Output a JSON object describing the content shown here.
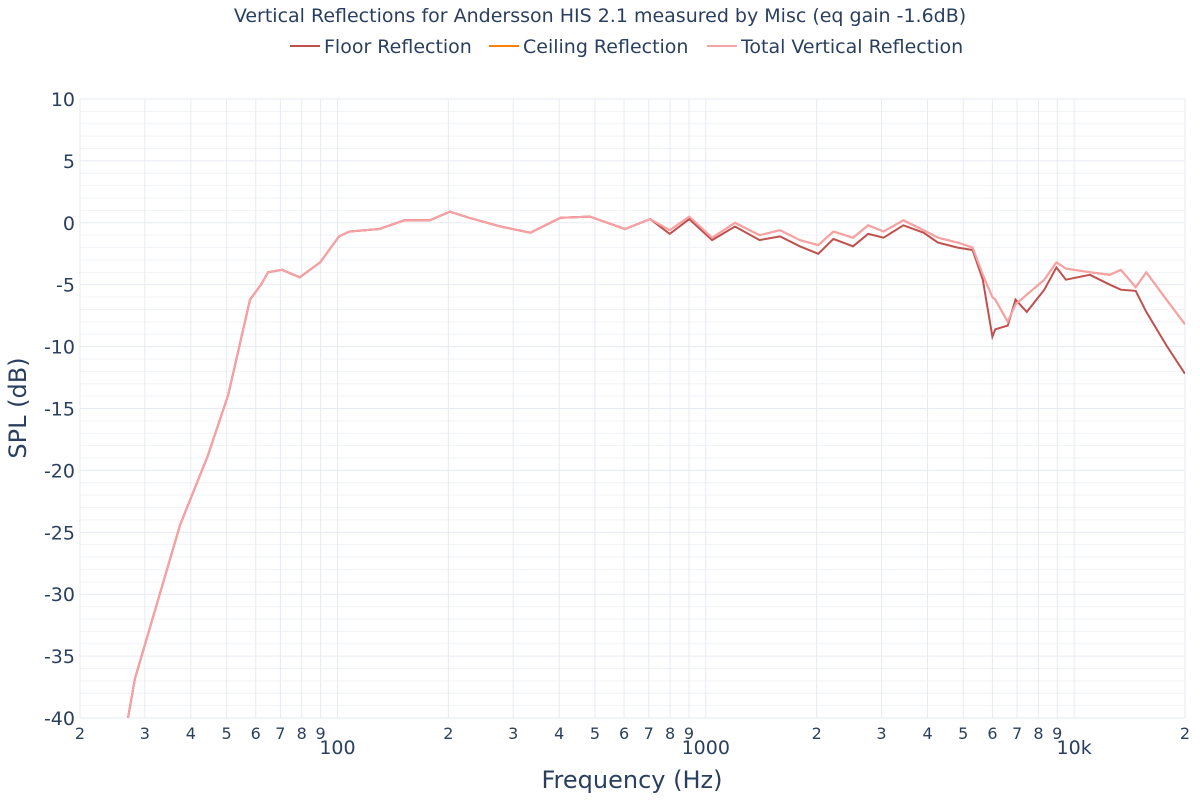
{
  "chart_data": {
    "type": "line",
    "title": "Vertical Reflections for Andersson HIS 2.1 measured by Misc (eq gain -1.6dB)",
    "xlabel": "Frequency (Hz)",
    "ylabel": "SPL (dB)",
    "x_scale": "log",
    "xlim": [
      20,
      20000
    ],
    "ylim": [
      -40,
      10
    ],
    "grid": true,
    "legend_position": "top",
    "y_ticks": [
      "10",
      "5",
      "0",
      "-5",
      "-10",
      "-15",
      "-20",
      "-25",
      "-30",
      "-35",
      "-40"
    ],
    "x_ticks": [
      {
        "v": 20,
        "l": "2"
      },
      {
        "v": 30,
        "l": "3"
      },
      {
        "v": 40,
        "l": "4"
      },
      {
        "v": 50,
        "l": "5"
      },
      {
        "v": 60,
        "l": "6"
      },
      {
        "v": 70,
        "l": "7"
      },
      {
        "v": 80,
        "l": "8"
      },
      {
        "v": 90,
        "l": "9"
      },
      {
        "v": 100,
        "l": "100",
        "major": true
      },
      {
        "v": 200,
        "l": "2"
      },
      {
        "v": 300,
        "l": "3"
      },
      {
        "v": 400,
        "l": "4"
      },
      {
        "v": 500,
        "l": "5"
      },
      {
        "v": 600,
        "l": "6"
      },
      {
        "v": 700,
        "l": "7"
      },
      {
        "v": 800,
        "l": "8"
      },
      {
        "v": 900,
        "l": "9"
      },
      {
        "v": 1000,
        "l": "1000",
        "major": true
      },
      {
        "v": 2000,
        "l": "2"
      },
      {
        "v": 3000,
        "l": "3"
      },
      {
        "v": 4000,
        "l": "4"
      },
      {
        "v": 5000,
        "l": "5"
      },
      {
        "v": 6000,
        "l": "6"
      },
      {
        "v": 7000,
        "l": "7"
      },
      {
        "v": 8000,
        "l": "8"
      },
      {
        "v": 9000,
        "l": "9"
      },
      {
        "v": 10000,
        "l": "10k",
        "major": true
      },
      {
        "v": 20000,
        "l": "2"
      }
    ],
    "x": [
      27,
      28.2,
      37.4,
      44.5,
      50.5,
      57.9,
      62,
      64.8,
      70.7,
      79,
      89.7,
      101,
      108,
      130,
      152,
      178,
      202,
      228,
      277,
      334,
      403,
      485,
      603,
      706,
      798,
      902,
      1040,
      1200,
      1400,
      1590,
      1800,
      2020,
      2220,
      2510,
      2760,
      3040,
      3440,
      3900,
      4270,
      4830,
      5300,
      5650,
      6000,
      6110,
      6600,
      6930,
      7440,
      8300,
      8950,
      9500,
      11040,
      12500,
      13400,
      14700,
      15700,
      17800,
      20000
    ],
    "series": [
      {
        "name": "Ceiling Reflection",
        "color": "#ff7f0e",
        "values": [
          -40,
          -36.8,
          -24.4,
          -18.8,
          -13.9,
          -6.2,
          -5,
          -4,
          -3.8,
          -4.4,
          -3.2,
          -1.1,
          -0.7,
          -0.5,
          0.2,
          0.2,
          0.9,
          0.4,
          -0.3,
          -0.8,
          0.4,
          0.5,
          -0.5,
          0.3,
          -0.6,
          0.5,
          -1.2,
          0,
          -1,
          -0.6,
          -1.4,
          -1.8,
          -0.7,
          -1.2,
          -0.2,
          -0.7,
          0.2,
          -0.6,
          -1.2,
          -1.6,
          -2.0,
          -4.2,
          -6.0,
          -6.2,
          -8,
          -6.6,
          -5.8,
          -4.6,
          -3.2,
          -3.7,
          -4.0,
          -4.2,
          -3.8,
          -5.2,
          -4.0,
          -6.2,
          -8.2
        ]
      },
      {
        "name": "Floor Reflection",
        "color": "#c0504d",
        "values": [
          -40,
          -36.8,
          -24.4,
          -18.8,
          -13.9,
          -6.2,
          -5,
          -4,
          -3.8,
          -4.4,
          -3.2,
          -1.1,
          -0.7,
          -0.5,
          0.2,
          0.2,
          0.9,
          0.4,
          -0.3,
          -0.8,
          0.4,
          0.5,
          -0.5,
          0.3,
          -0.9,
          0.3,
          -1.4,
          -0.3,
          -1.4,
          -1.1,
          -1.9,
          -2.5,
          -1.3,
          -1.9,
          -0.9,
          -1.2,
          -0.2,
          -0.8,
          -1.6,
          -2.0,
          -2.2,
          -4.6,
          -9.2,
          -8.6,
          -8.3,
          -6.2,
          -7.2,
          -5.4,
          -3.6,
          -4.6,
          -4.2,
          -5.0,
          -5.4,
          -5.5,
          -7.2,
          -9.9,
          -12.2
        ]
      },
      {
        "name": "Total Vertical Reflection",
        "color": "#f7a1a8",
        "values": [
          -40,
          -36.8,
          -24.4,
          -18.8,
          -13.9,
          -6.2,
          -5,
          -4,
          -3.8,
          -4.4,
          -3.2,
          -1.1,
          -0.7,
          -0.5,
          0.2,
          0.2,
          0.9,
          0.4,
          -0.3,
          -0.8,
          0.4,
          0.5,
          -0.5,
          0.3,
          -0.6,
          0.5,
          -1.2,
          0,
          -1,
          -0.6,
          -1.4,
          -1.8,
          -0.7,
          -1.2,
          -0.2,
          -0.7,
          0.2,
          -0.6,
          -1.2,
          -1.6,
          -2.0,
          -4.2,
          -6.0,
          -6.2,
          -8,
          -6.6,
          -5.8,
          -4.6,
          -3.2,
          -3.7,
          -4.0,
          -4.2,
          -3.8,
          -5.2,
          -4.0,
          -6.2,
          -8.2
        ]
      }
    ],
    "legend_order": [
      1,
      0,
      2
    ]
  }
}
